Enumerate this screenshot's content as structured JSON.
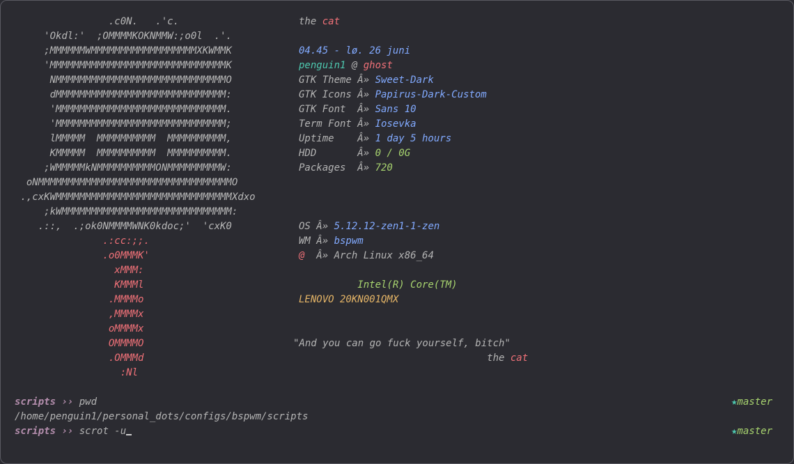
{
  "art_white": [
    "                .c0N.   .'c.",
    "     'Okdl:'  ;OMMMMKOKNMMW:;o0l  .'.",
    "     ;MMMMMMWMMMMMMMMMMMMMMMMMMXKWMMK",
    "     'MMMMMMMMMMMMMMMMMMMMMMMMMMMMMMK",
    "      NMMMMMMMMMMMMMMMMMMMMMMMMMMMMMO",
    "      dMMMMMMMMMMMMMMMMMMMMMMMMMMMMM:",
    "      'MMMMMMMMMMMMMMMMMMMMMMMMMMMMM.",
    "      'MMMMMMMMMMMMMMMMMMMMMMMMMMMMM;",
    "      lMMMMM  MMMMMMMMMM  MMMMMMMMMM,",
    "      KMMMMM  MMMMMMMMMM  MMMMMMMMMM.",
    "     ;WMMMMMkNMMMMMMMMMMONMMMMMMMMMW:",
    "  oNMMMMMMMMMMMMMMMMMMMMMMMMMMMMMMMMMO",
    " .,cxKWMMMMMMMMMMMMMMMMMMMMMMMMMMMMMMXdxo",
    "     ;kWMMMMMMMMMMMMMMMMMMMMMMMMMMMMM:",
    "    .::,  .;ok0NMMMMWNK0kdoc;'  'cxK0"
  ],
  "art_red": [
    "               .:cc:;;.",
    "               .o0MMMK'",
    "                 xMMM:",
    "                 KMMMl",
    "                .MMMMo",
    "                ,MMMMx",
    "                oMMMMx",
    "                OMMMMO",
    "                .OMMMd",
    "                  :Nl"
  ],
  "info": {
    "title_prefix": "the ",
    "title_name": "cat",
    "time": "04.45 - lø. 26 juni",
    "user": "penguin1",
    "at": " @ ",
    "host": "ghost",
    "rows": [
      {
        "key": "GTK Theme Â» ",
        "value": "Sweet-Dark",
        "color": "blue"
      },
      {
        "key": "GTK Icons Â» ",
        "value": "Papirus-Dark-Custom",
        "color": "blue"
      },
      {
        "key": "GTK Font  Â» ",
        "value": "Sans 10",
        "color": "blue"
      },
      {
        "key": "Term Font Â» ",
        "value": "Iosevka",
        "color": "blue"
      },
      {
        "key": "Uptime    Â» ",
        "value": "1 day 5 hours",
        "color": "blue"
      },
      {
        "key": "HDD       Â» ",
        "value": "0 / 0G",
        "color": "green"
      },
      {
        "key": "Packages  Â» ",
        "value": "720",
        "color": "green"
      }
    ],
    "os_key": "OS Â» ",
    "os_value": "5.12.12-zen1-1-zen",
    "wm_key": "WM Â» ",
    "wm_value": "bspwm",
    "distro_icon": "@",
    "distro_sep": "  Â» ",
    "distro_value": "Arch Linux x86_64",
    "cpu": "          Intel(R) Core(TM)",
    "model": "LENOVO 20KN001QMX"
  },
  "quote": {
    "text": "\"And you can go fuck yourself, bitch\"",
    "sign_prefix": "                                 the ",
    "sign_name": "cat"
  },
  "shell": {
    "dir": "scripts",
    "arrow": " ›› ",
    "cmd1": "pwd",
    "output": "/home/penguin1/personal_dots/configs/bspwm/scripts",
    "cmd2": "scrot -u",
    "git_branch": "master",
    "git_icon": "git-branch-icon"
  }
}
